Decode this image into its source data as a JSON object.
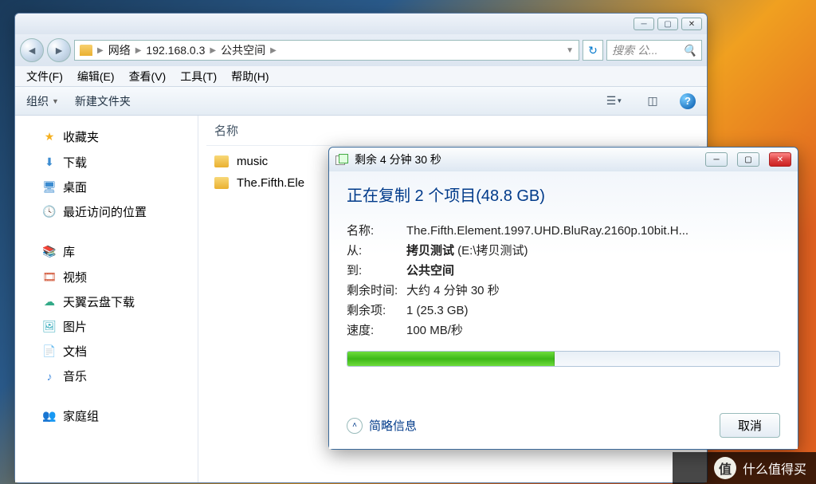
{
  "explorer": {
    "breadcrumb": [
      "网络",
      "192.168.0.3",
      "公共空间"
    ],
    "search_placeholder": "搜索 公...",
    "menu": {
      "file": "文件(F)",
      "edit": "编辑(E)",
      "view": "查看(V)",
      "tools": "工具(T)",
      "help": "帮助(H)"
    },
    "toolbar": {
      "organize": "组织",
      "new_folder": "新建文件夹"
    },
    "column_header": "名称",
    "sidebar": {
      "favorites": {
        "label": "收藏夹",
        "items": [
          "下载",
          "桌面",
          "最近访问的位置"
        ]
      },
      "libraries": {
        "label": "库",
        "items": [
          "视频",
          "天翼云盘下载",
          "图片",
          "文档",
          "音乐"
        ]
      },
      "homegroup": {
        "label": "家庭组"
      }
    },
    "files": [
      "music",
      "The.Fifth.Ele"
    ]
  },
  "dialog": {
    "title": "剩余 4 分钟 30 秒",
    "heading": "正在复制 2 个项目(48.8 GB)",
    "labels": {
      "name": "名称:",
      "from": "从:",
      "to": "到:",
      "remaining_time": "剩余时间:",
      "remaining_items": "剩余项:",
      "speed": "速度:"
    },
    "values": {
      "name": "The.Fifth.Element.1997.UHD.BluRay.2160p.10bit.H...",
      "from_bold": "拷贝测试",
      "from_path": " (E:\\拷贝测试)",
      "to": "公共空间",
      "remaining_time": "大约 4 分钟 30 秒",
      "remaining_items": "1 (25.3 GB)",
      "speed": "100 MB/秒"
    },
    "progress_percent": 48,
    "less_info": "简略信息",
    "cancel": "取消"
  },
  "watermark": {
    "text": "什么值得买",
    "badge": "值"
  }
}
